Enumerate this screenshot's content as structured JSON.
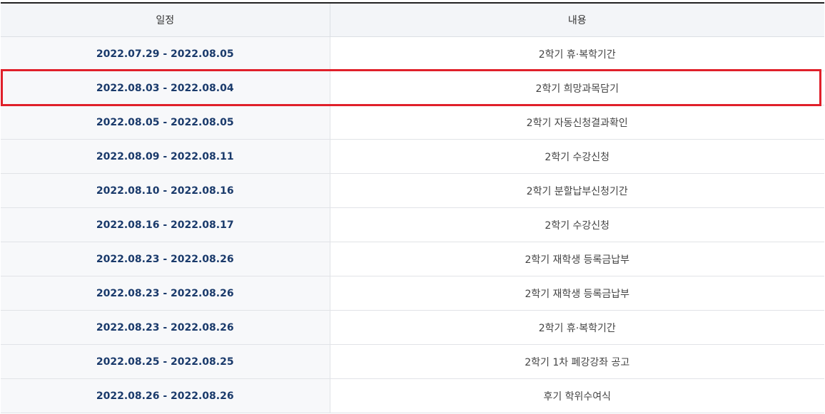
{
  "table": {
    "headers": {
      "date": "일정",
      "content": "내용"
    },
    "rows": [
      {
        "date": "2022.07.29 - 2022.08.05",
        "content": "2학기 휴·복학기간"
      },
      {
        "date": "2022.08.03 - 2022.08.04",
        "content": "2학기 희망과목담기"
      },
      {
        "date": "2022.08.05 - 2022.08.05",
        "content": "2학기 자동신청결과확인"
      },
      {
        "date": "2022.08.09 - 2022.08.11",
        "content": "2학기 수강신청"
      },
      {
        "date": "2022.08.10 - 2022.08.16",
        "content": "2학기 분할납부신청기간"
      },
      {
        "date": "2022.08.16 - 2022.08.17",
        "content": "2학기 수강신청"
      },
      {
        "date": "2022.08.23 - 2022.08.26",
        "content": "2학기 재학생 등록금납부"
      },
      {
        "date": "2022.08.23 - 2022.08.26",
        "content": "2학기 재학생 등록금납부"
      },
      {
        "date": "2022.08.23 - 2022.08.26",
        "content": "2학기 휴·복학기간"
      },
      {
        "date": "2022.08.25 - 2022.08.25",
        "content": "2학기 1차 폐강강좌 공고"
      },
      {
        "date": "2022.08.26 - 2022.08.26",
        "content": "후기 학위수여식"
      }
    ]
  },
  "colors": {
    "highlight": "#e0202a",
    "date_text": "#1a3a6b",
    "header_bg": "#f3f5f8"
  },
  "highlighted_row": 1
}
